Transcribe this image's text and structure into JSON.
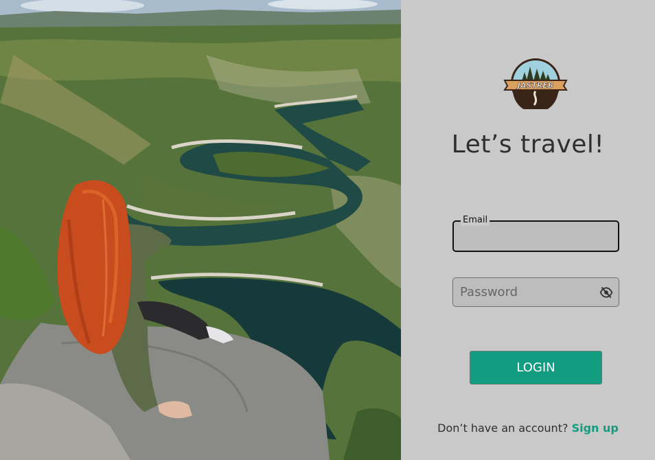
{
  "brand": {
    "logo_text": "JASTREB"
  },
  "login": {
    "title": "Let’s travel!",
    "email_label": "Email",
    "email_value": "",
    "password_placeholder": "Password",
    "password_value": "",
    "login_button": "LOGIN",
    "signup_prompt": "Don’t have an account?",
    "signup_link": "Sign up"
  },
  "colors": {
    "accent": "#149c81",
    "panel_background": "#c9c9c9",
    "field_background": "#bdbdbd"
  },
  "icons": {
    "password_toggle": "eye-off-icon"
  }
}
